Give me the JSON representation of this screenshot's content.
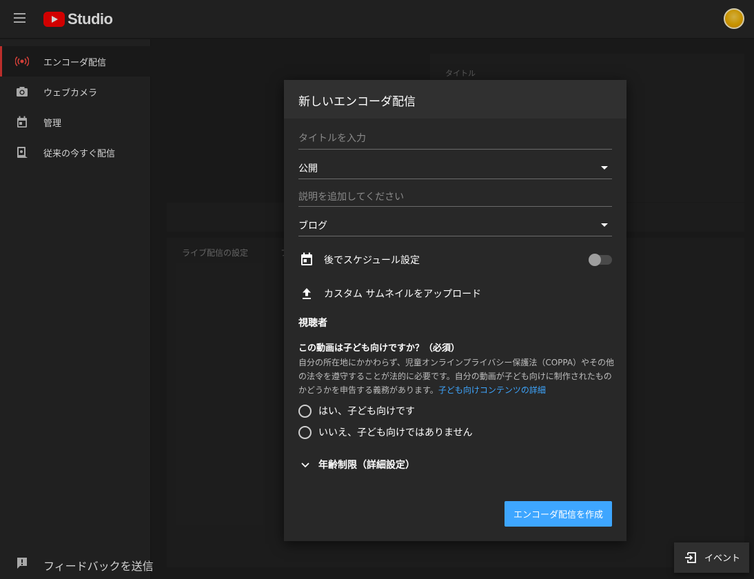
{
  "header": {
    "logo_text": "Studio"
  },
  "sidebar": {
    "items": [
      {
        "label": "エンコーダ配信"
      },
      {
        "label": "ウェブカメラ"
      },
      {
        "label": "管理"
      },
      {
        "label": "従来の今すぐ配信"
      }
    ],
    "feedback_label": "フィードバックを送信"
  },
  "background": {
    "title_label": "タイトル",
    "stream_settings_tab": "ライブ配信の設定",
    "second_tab_partial": "フ"
  },
  "modal": {
    "title": "新しいエンコーダ配信",
    "title_placeholder": "タイトルを入力",
    "visibility_value": "公開",
    "description_placeholder": "説明を追加してください",
    "category_value": "ブログ",
    "schedule_label": "後でスケジュール設定",
    "schedule_enabled": false,
    "thumbnail_label": "カスタム サムネイルをアップロード",
    "audience_title": "視聴者",
    "kids_question": "この動画は子ども向けですか？（必須）",
    "kids_description": "自分の所在地にかかわらず、児童オンラインプライバシー保護法（COPPA）やその他の法令を遵守することが法的に必要です。自分の動画が子ども向けに制作されたものかどうかを申告する義務があります。",
    "kids_link": "子ども向けコンテンツの詳細",
    "option_yes": "はい、子ども向けです",
    "option_no": "いいえ、子ども向けではありません",
    "age_restriction_label": "年齢制限（詳細設定）",
    "create_button": "エンコーダ配信を作成"
  },
  "event_button": {
    "label": "イベント"
  },
  "colors": {
    "accent_blue": "#3ea6ff",
    "active_red": "#e53935",
    "brand_red": "#ff0000"
  }
}
